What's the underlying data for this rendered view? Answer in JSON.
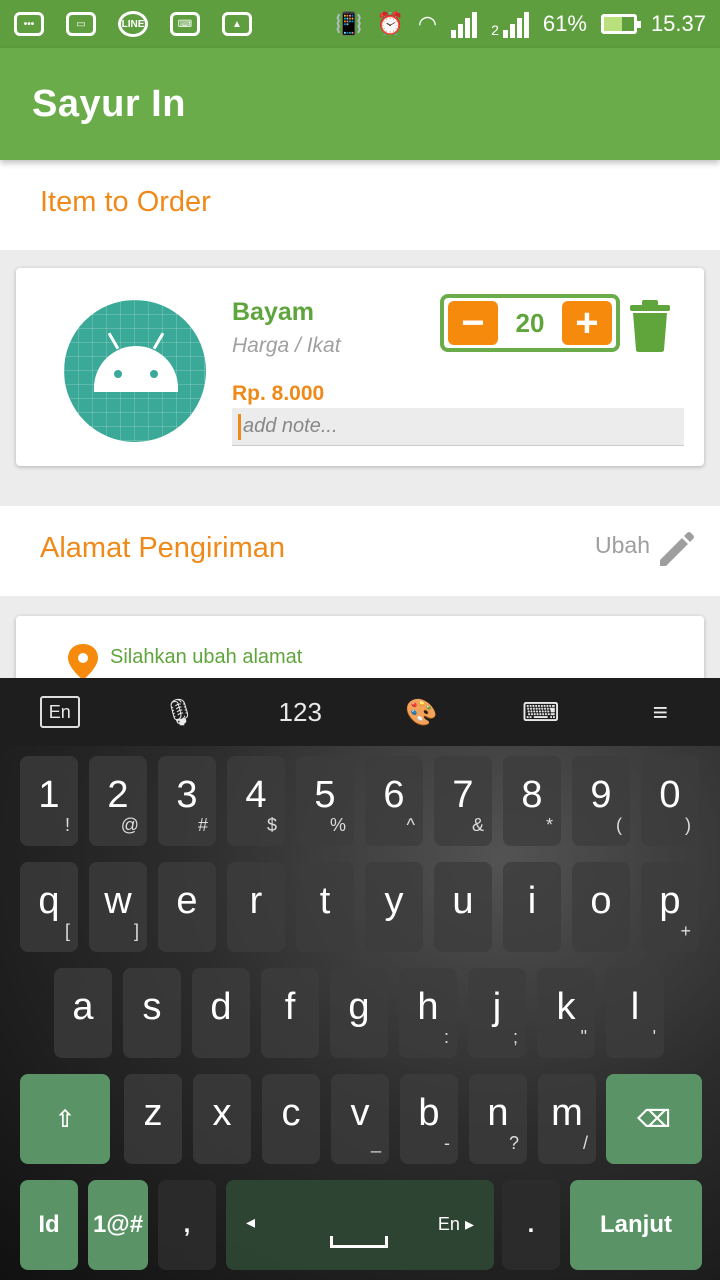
{
  "status_bar": {
    "battery": "61%",
    "time": "15.37",
    "line_label": "LINE",
    "sim2_label": "2"
  },
  "app_bar": {
    "title": "Sayur In"
  },
  "order_section": {
    "title": "Item to Order"
  },
  "item": {
    "name": "Bayam",
    "unit": "Harga / Ikat",
    "price": "Rp. 8.000",
    "note_placeholder": "add note...",
    "quantity": "20",
    "minus": "−",
    "plus": "+"
  },
  "address_section": {
    "title": "Alamat Pengiriman",
    "edit_label": "Ubah",
    "address_text": "Silahkan ubah alamat"
  },
  "keyboard": {
    "toolbar": {
      "lang": "En",
      "numbers": "123"
    },
    "row_numbers": [
      {
        "main": "1",
        "sub": "!"
      },
      {
        "main": "2",
        "sub": "@"
      },
      {
        "main": "3",
        "sub": "#"
      },
      {
        "main": "4",
        "sub": "$"
      },
      {
        "main": "5",
        "sub": "%"
      },
      {
        "main": "6",
        "sub": "^"
      },
      {
        "main": "7",
        "sub": "&"
      },
      {
        "main": "8",
        "sub": "*"
      },
      {
        "main": "9",
        "sub": "("
      },
      {
        "main": "0",
        "sub": ")"
      }
    ],
    "row_qwerty": [
      {
        "main": "q",
        "sub": "["
      },
      {
        "main": "w",
        "sub": "]"
      },
      {
        "main": "e",
        "sub": ""
      },
      {
        "main": "r",
        "sub": ""
      },
      {
        "main": "t",
        "sub": ""
      },
      {
        "main": "y",
        "sub": ""
      },
      {
        "main": "u",
        "sub": ""
      },
      {
        "main": "i",
        "sub": ""
      },
      {
        "main": "o",
        "sub": ""
      },
      {
        "main": "p",
        "sub": "+"
      }
    ],
    "row_asdf": [
      {
        "main": "a",
        "sub": ""
      },
      {
        "main": "s",
        "sub": ""
      },
      {
        "main": "d",
        "sub": ""
      },
      {
        "main": "f",
        "sub": ""
      },
      {
        "main": "g",
        "sub": ""
      },
      {
        "main": "h",
        "sub": ":"
      },
      {
        "main": "j",
        "sub": ";"
      },
      {
        "main": "k",
        "sub": "\""
      },
      {
        "main": "l",
        "sub": "'"
      }
    ],
    "row_zxcv": [
      {
        "main": "z",
        "sub": ""
      },
      {
        "main": "x",
        "sub": ""
      },
      {
        "main": "c",
        "sub": ""
      },
      {
        "main": "v",
        "sub": "_"
      },
      {
        "main": "b",
        "sub": "-"
      },
      {
        "main": "n",
        "sub": "?"
      },
      {
        "main": "m",
        "sub": "/"
      }
    ],
    "bottom": {
      "lang_key": "Id",
      "symbols_key": "1@#",
      "comma": ",",
      "space_lang": "En",
      "period": ".",
      "enter": "Lanjut"
    }
  },
  "colors": {
    "brand_green": "#6aab4a",
    "accent_orange": "#ef8a1a",
    "keyboard_green": "#5a9466"
  }
}
